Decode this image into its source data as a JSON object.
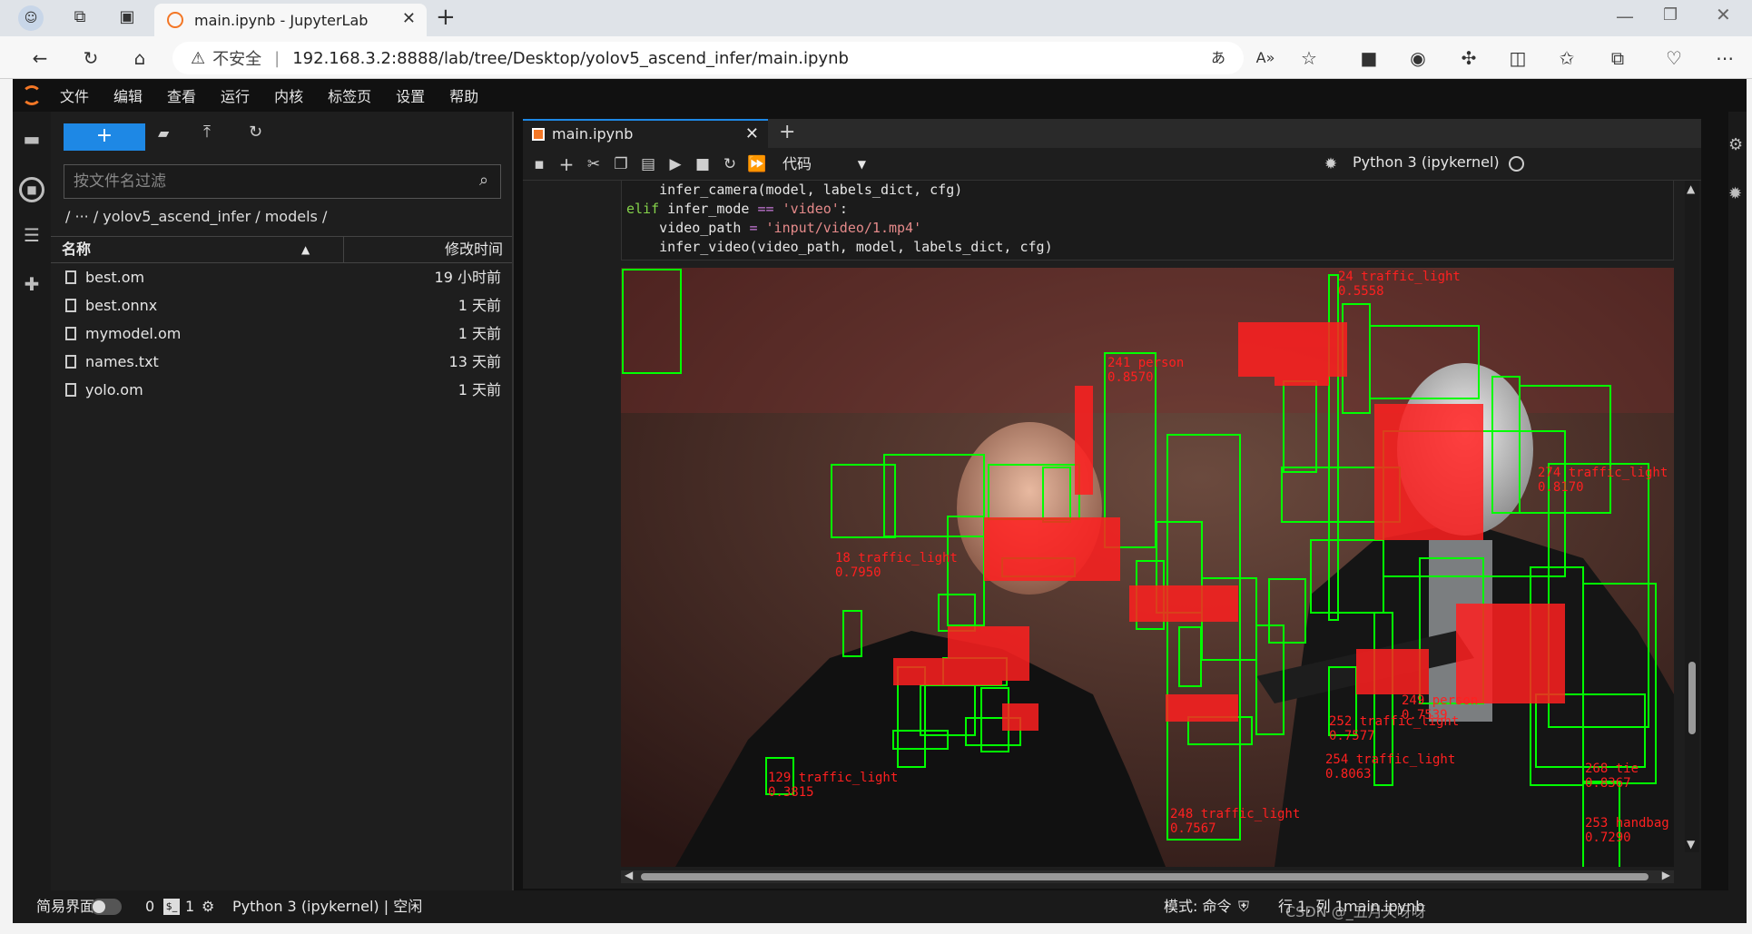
{
  "browser": {
    "tab_title": "main.ipynb - JupyterLab",
    "security_label": "不安全",
    "url": "192.168.3.2:8888/lab/tree/Desktop/yolov5_ascend_infer/main.ipynb"
  },
  "menu": [
    "文件",
    "编辑",
    "查看",
    "运行",
    "内核",
    "标签页",
    "设置",
    "帮助"
  ],
  "filebrowser": {
    "new_label": "+",
    "filter_placeholder": "按文件名过滤",
    "breadcrumb": "/  ···  / yolov5_ascend_infer / models /",
    "col_name": "名称",
    "col_modified": "修改时间",
    "files": [
      {
        "name": "best.om",
        "modified": "19 小时前"
      },
      {
        "name": "best.onnx",
        "modified": "1 天前"
      },
      {
        "name": "mymodel.om",
        "modified": "1 天前"
      },
      {
        "name": "names.txt",
        "modified": "13 天前"
      },
      {
        "name": "yolo.om",
        "modified": "1 天前"
      }
    ]
  },
  "notebook": {
    "tab_label": "main.ipynb",
    "cell_type": "代码",
    "kernel_name": "Python 3 (ipykernel)",
    "code": {
      "line1": "    infer_camera(model, labels_dict, cfg)",
      "line2_kw": "elif",
      "line2_rest": " infer_mode ",
      "line2_op": "==",
      "line2_str": " 'video'",
      "line2_end": ":",
      "line3_a": "    video_path ",
      "line3_op": "=",
      "line3_str": " 'input/video/1.mp4'",
      "line4": "    infer_video(video_path, model, labels_dict, cfg)"
    },
    "detections": [
      {
        "label": "129 traffic_light",
        "score": "0.3815"
      },
      {
        "label": "248 traffic_light",
        "score": "0.7567"
      },
      {
        "label": "252 traffic_light",
        "score": "0.7577"
      },
      {
        "label": "254 traffic_light",
        "score": "0.8063"
      },
      {
        "label": "249 person",
        "score": "0.7539"
      },
      {
        "label": "268 tie",
        "score": "0.8367"
      },
      {
        "label": "253 handbag",
        "score": "0.7290"
      },
      {
        "label": "24 traffic_light",
        "score": "0.5558"
      },
      {
        "label": "241 person",
        "score": "0.8570"
      },
      {
        "label": "274 traffic_light",
        "score": "0.8170"
      },
      {
        "label": "18 traffic_light",
        "score": "0.7950"
      }
    ]
  },
  "status": {
    "simple_mode": "简易界面",
    "count0": "0",
    "count1": "1",
    "kernel_status": "Python 3 (ipykernel) | 空闲",
    "mode": "模式: 命令",
    "position": "行 1, 列 1",
    "file": "main.ipynb",
    "watermark": "CSDN @_五月天呀呀"
  },
  "colors": {
    "accent": "#1e88e5",
    "box": "#00ff00",
    "label": "#ff2020"
  }
}
